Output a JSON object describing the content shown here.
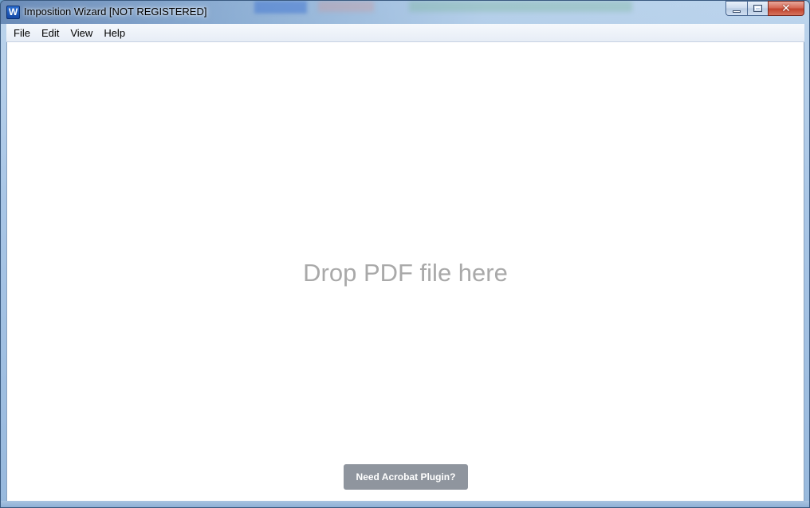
{
  "window": {
    "title": "Imposition Wizard [NOT REGISTERED]",
    "app_icon_glyph": "W",
    "app_icon_name": "imposition-wizard-app-icon",
    "caption_buttons": {
      "minimize_icon": "minimize-icon",
      "maximize_icon": "maximize-icon",
      "close_glyph": "✕",
      "close_icon": "close-icon"
    }
  },
  "menubar": {
    "items": [
      {
        "label": "File"
      },
      {
        "label": "Edit"
      },
      {
        "label": "View"
      },
      {
        "label": "Help"
      }
    ]
  },
  "main": {
    "drop_text": "Drop PDF file here",
    "plugin_button_label": "Need Acrobat Plugin?"
  },
  "colors": {
    "drop_text": "#a9a9a9",
    "plugin_button_bg": "#8f959e",
    "close_button": "#c2432d",
    "app_icon": "#1f5cbf"
  }
}
